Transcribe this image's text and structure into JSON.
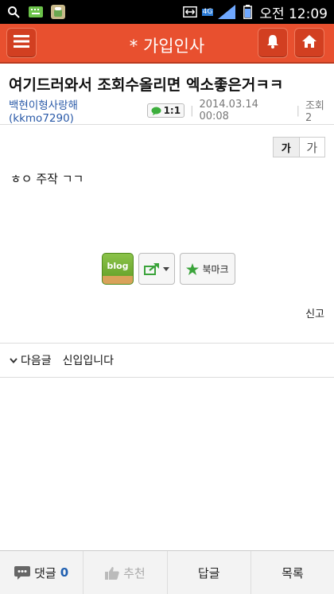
{
  "status_bar": {
    "network": "4G",
    "time": "오전 12:09"
  },
  "app_bar": {
    "title": "* 가입인사"
  },
  "post": {
    "title": "여기드러와서 조회수올리면 엑소좋은거ㅋㅋ",
    "author": "백현이형사랑해(kkmo7290)",
    "chat_label": "1:1",
    "date": "2014.03.14 00:08",
    "views": "조회 2",
    "body": "ㅎㅇ 주작 ㄱㄱ"
  },
  "font_size": {
    "small_label": "가",
    "large_label": "가"
  },
  "actions": {
    "blog_label": "blog",
    "bookmark_label": "북마크",
    "report_label": "신고"
  },
  "next_post": {
    "label": "다음글",
    "title": "신입입니다"
  },
  "bottom_bar": {
    "comment_label": "댓글",
    "comment_count": "0",
    "recommend_label": "추천",
    "reply_label": "답글",
    "list_label": "목록"
  },
  "colors": {
    "app_bar": "#e8502f",
    "author_link": "#2a5aa8",
    "comment_count": "#1f5fb0"
  }
}
